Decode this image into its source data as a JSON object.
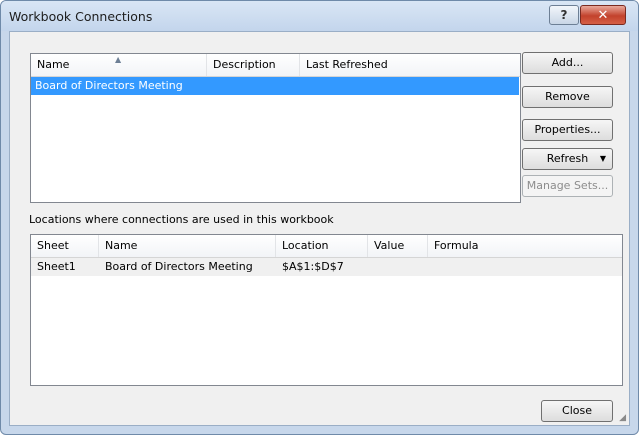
{
  "window": {
    "title": "Workbook Connections",
    "help_label": "?",
    "close_label": "✕"
  },
  "connections_list": {
    "columns": [
      {
        "label": "Name"
      },
      {
        "label": "Description"
      },
      {
        "label": "Last Refreshed"
      }
    ],
    "rows": [
      {
        "name": "Board of Directors Meeting",
        "description": "",
        "last_refreshed": ""
      }
    ]
  },
  "buttons": {
    "add": "Add...",
    "remove": "Remove",
    "properties": "Properties...",
    "refresh": "Refresh",
    "manage_sets": "Manage Sets...",
    "close": "Close"
  },
  "locations": {
    "label": "Locations where connections are used in this workbook",
    "columns": [
      {
        "label": "Sheet"
      },
      {
        "label": "Name"
      },
      {
        "label": "Location"
      },
      {
        "label": "Value"
      },
      {
        "label": "Formula"
      }
    ],
    "rows": [
      {
        "sheet": "Sheet1",
        "name": "Board of Directors Meeting",
        "location": "$A$1:$D$7",
        "value": "",
        "formula": ""
      }
    ]
  },
  "icons": {
    "sort": "sort-ascending-icon",
    "dropdown": "chevron-down-icon",
    "grip": "resize-grip-icon"
  },
  "colors": {
    "selection": "#3399ff",
    "frame": "#c7d7eb"
  }
}
